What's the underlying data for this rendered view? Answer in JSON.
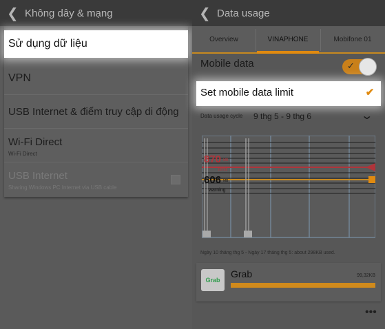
{
  "left": {
    "title": "Không dây & mạng",
    "items": [
      {
        "label": "Sử dụng dữ liệu"
      },
      {
        "label": "VPN"
      },
      {
        "label": "USB Internet & điểm truy cập di động"
      },
      {
        "label": "Wi-Fi Direct",
        "sub": "Wi-Fi Direct"
      },
      {
        "label": "USB Internet",
        "sub": "Sharing Windows PC Internet via USB cable"
      }
    ]
  },
  "right": {
    "title": "Data usage",
    "tabs": [
      "Overview",
      "VINAPHONE",
      "Mobifone 01"
    ],
    "mobile_data_label": "Mobile data",
    "mobile_data_on": true,
    "limit_label": "Set mobile data limit",
    "limit_checked": true,
    "cycle_label": "Data usage cycle",
    "cycle_value": "9 thg 5 - 9 thg 6",
    "chart": {
      "limit_value": "870",
      "limit_unit": "MB",
      "limit_label": "limit",
      "warning_value": "606",
      "warning_unit": "MB",
      "warning_label": "warning"
    },
    "range_text": "Ngày 10 tháng thg 5 - Ngày 17 tháng thg 5: about 298KB used.",
    "app": {
      "icon_text": "Grab",
      "name": "Grab",
      "size": "99,32KB"
    },
    "accent_color": "#e08a10",
    "limit_color": "#b0343a"
  }
}
